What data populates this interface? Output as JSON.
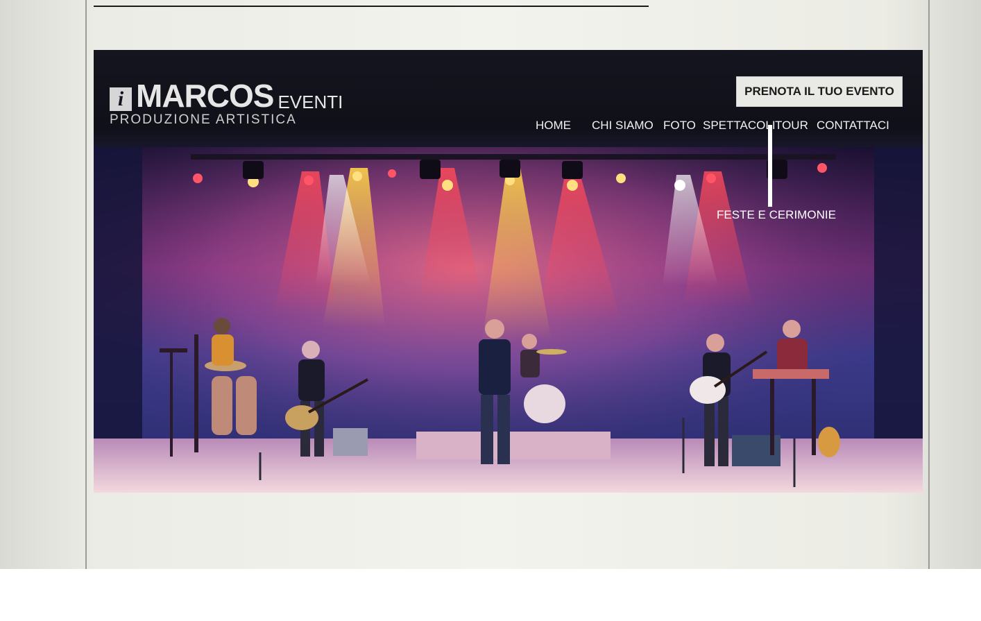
{
  "brand": {
    "badge_letter": "i",
    "name": "MARCOS",
    "suffix": "EVENTI",
    "tagline": "PRODUZIONE ARTISTICA"
  },
  "cta": {
    "label": "PRENOTA IL TUO EVENTO"
  },
  "nav": {
    "items": [
      {
        "label": "HOME"
      },
      {
        "label": "CHI SIAMO"
      },
      {
        "label": "FOTO"
      },
      {
        "label": "SPETTACOLI"
      },
      {
        "label": "TOUR"
      },
      {
        "label": "CONTATTACI"
      }
    ],
    "submenu": {
      "label": "FESTE E CERIMONIE"
    }
  },
  "hero": {
    "icon": "concert-stage-photo"
  },
  "colors": {
    "header_bg": "#15151f",
    "cta_bg": "#e9e9e6",
    "nav_text": "#f1f1f1",
    "stage_light_warm": "#ffb347",
    "stage_light_red": "#ff3b4a",
    "stage_haze": "#c85aa8"
  }
}
